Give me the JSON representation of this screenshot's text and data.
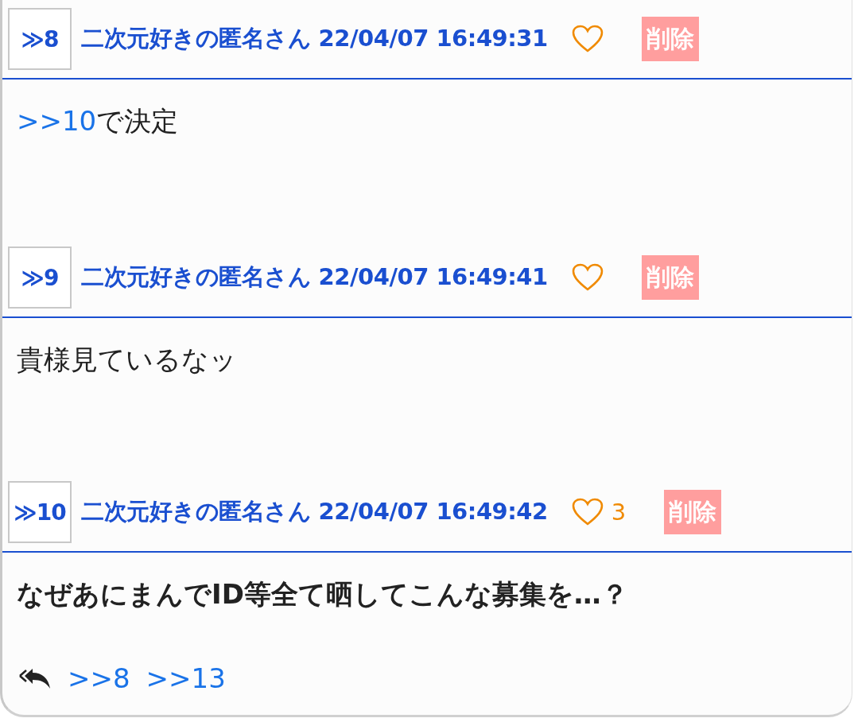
{
  "posts": [
    {
      "number": "≫8",
      "author_time": "二次元好きの匿名さん 22/04/07 16:49:31",
      "delete_label": "削除",
      "bold": false,
      "body": [
        {
          "kind": "link",
          "text": ">>10"
        },
        {
          "kind": "text",
          "text": "で決定"
        }
      ]
    },
    {
      "number": "≫9",
      "author_time": "二次元好きの匿名さん 22/04/07 16:49:41",
      "delete_label": "削除",
      "bold": false,
      "body": [
        {
          "kind": "text",
          "text": "貴様見ているなッ"
        }
      ]
    },
    {
      "number": "≫10",
      "author_time": "二次元好きの匿名さん 22/04/07 16:49:42",
      "likes": "3",
      "delete_label": "削除",
      "bold": true,
      "body": [
        {
          "kind": "text",
          "text": "なぜあにまんでID等全て晒してこんな募集を…？"
        }
      ],
      "replies": [
        ">>8",
        ">>13"
      ]
    }
  ]
}
